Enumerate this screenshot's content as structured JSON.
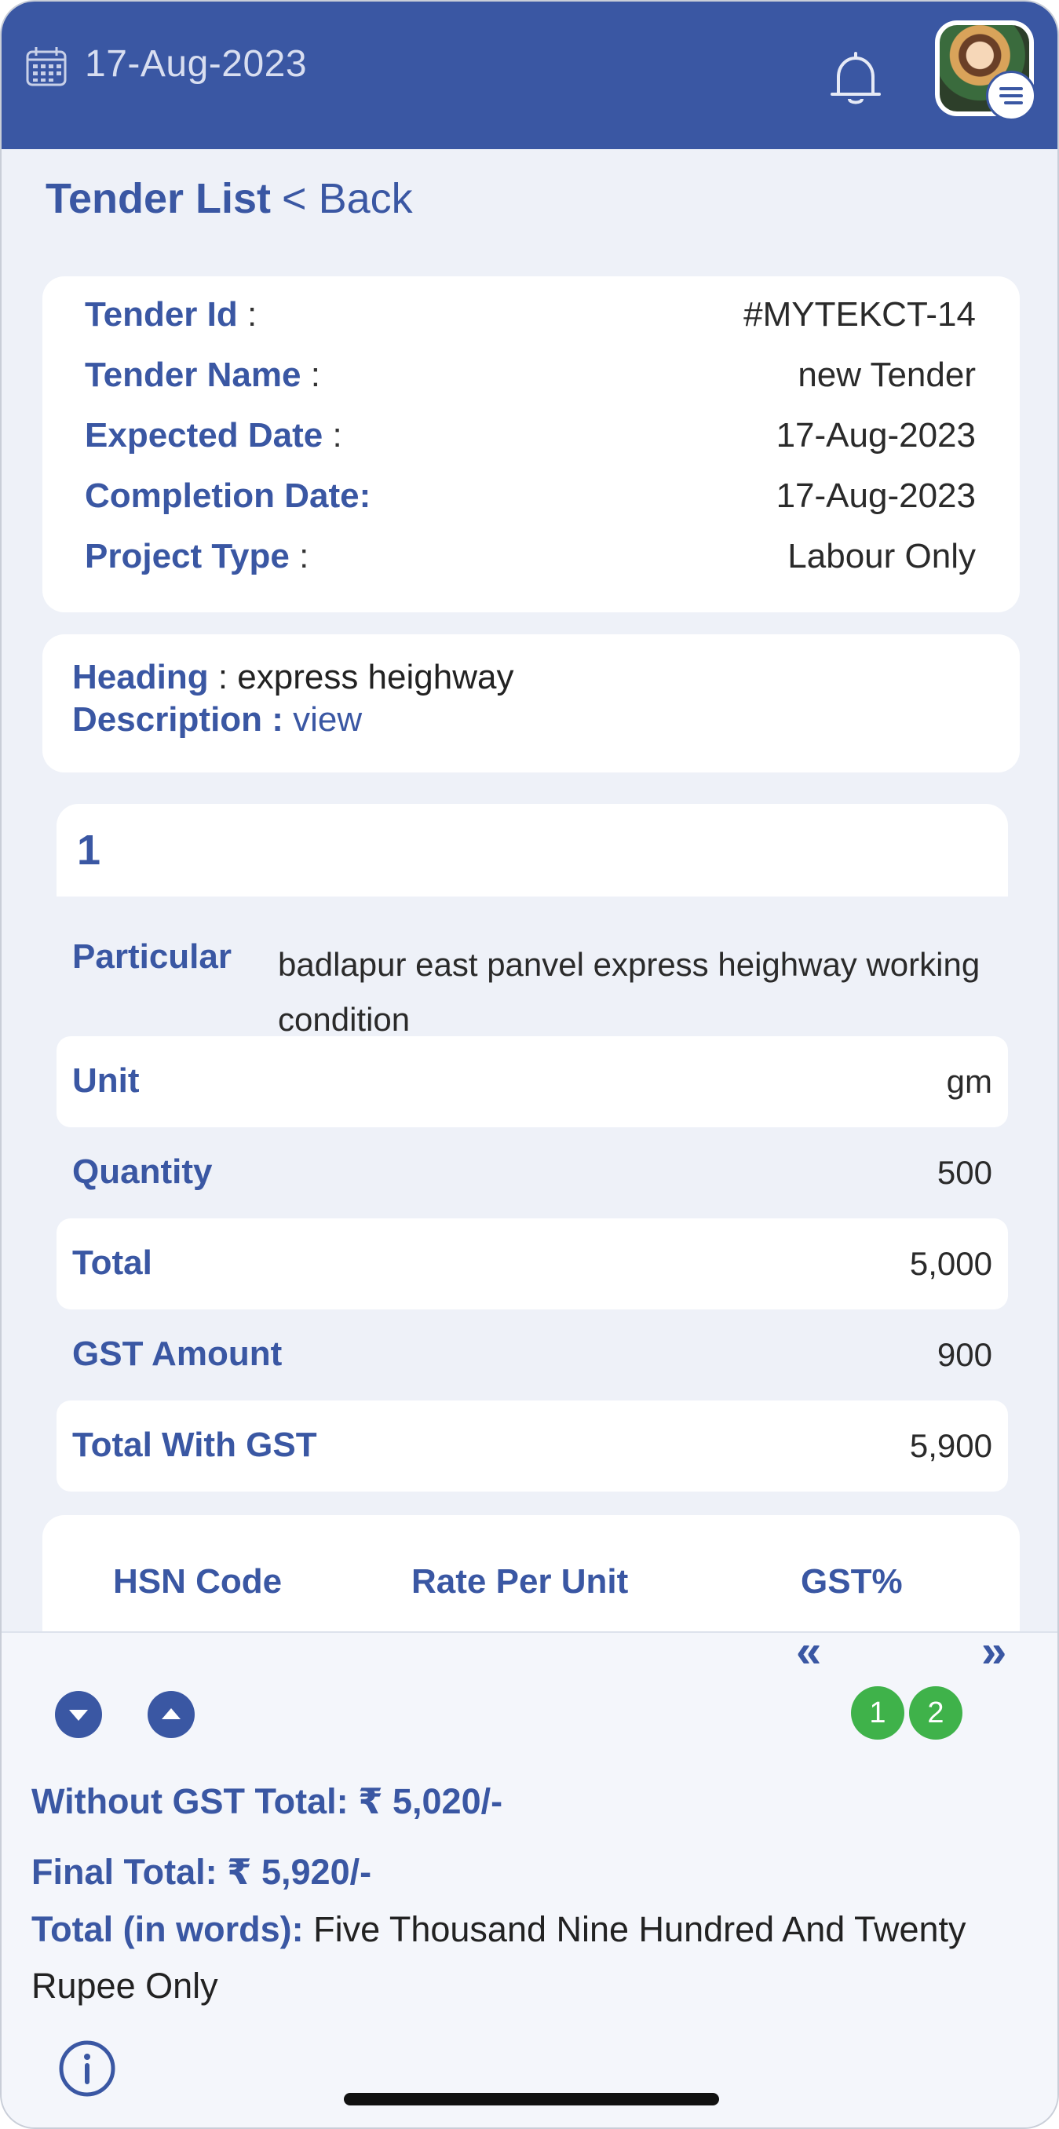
{
  "header": {
    "date": "17-Aug-2023",
    "icons": [
      "calendar-icon",
      "bell-icon",
      "menu-icon"
    ]
  },
  "nav": {
    "title": "Tender List",
    "back": "< Back"
  },
  "tender": {
    "id_label": "Tender Id",
    "id_value": "#MYTEKCT-14",
    "name_label": "Tender Name",
    "name_value": "new Tender",
    "expected_label": "Expected Date",
    "expected_value": "17-Aug-2023",
    "completion_label": "Completion Date:",
    "completion_value": "17-Aug-2023",
    "type_label": "Project Type",
    "type_value": "Labour Only",
    "colon": ":"
  },
  "heading": {
    "heading_label": "Heading",
    "heading_value": ": express heighway",
    "description_label": "Description :",
    "description_link": "view"
  },
  "item": {
    "number": "1",
    "particular_label": "Particular",
    "particular_value": "badlapur east panvel express heighway working condition",
    "unit_label": "Unit",
    "unit_value": "gm",
    "quantity_label": "Quantity",
    "quantity_value": "500",
    "total_label": "Total",
    "total_value": "5,000",
    "gst_amount_label": "GST Amount",
    "gst_amount_value": "900",
    "total_with_gst_label": "Total With GST",
    "total_with_gst_value": "5,900"
  },
  "hsn_table": {
    "headers": [
      "HSN Code",
      "Rate Per Unit",
      "GST%"
    ]
  },
  "pagination": {
    "prev": "«",
    "next": "»",
    "pages": [
      "1",
      "2"
    ]
  },
  "summary": {
    "without_gst_label": "Without GST Total:",
    "without_gst_value": "₹ 5,020/-",
    "final_label": "Final Total:",
    "final_value": "₹ 5,920/-",
    "words_label": "Total (in words):",
    "words_value": "Five Thousand Nine Hundred And Twenty Rupee Only"
  },
  "colors": {
    "primary": "#3a57a3",
    "page_active": "#3fb24a",
    "background": "#eef1f8"
  }
}
